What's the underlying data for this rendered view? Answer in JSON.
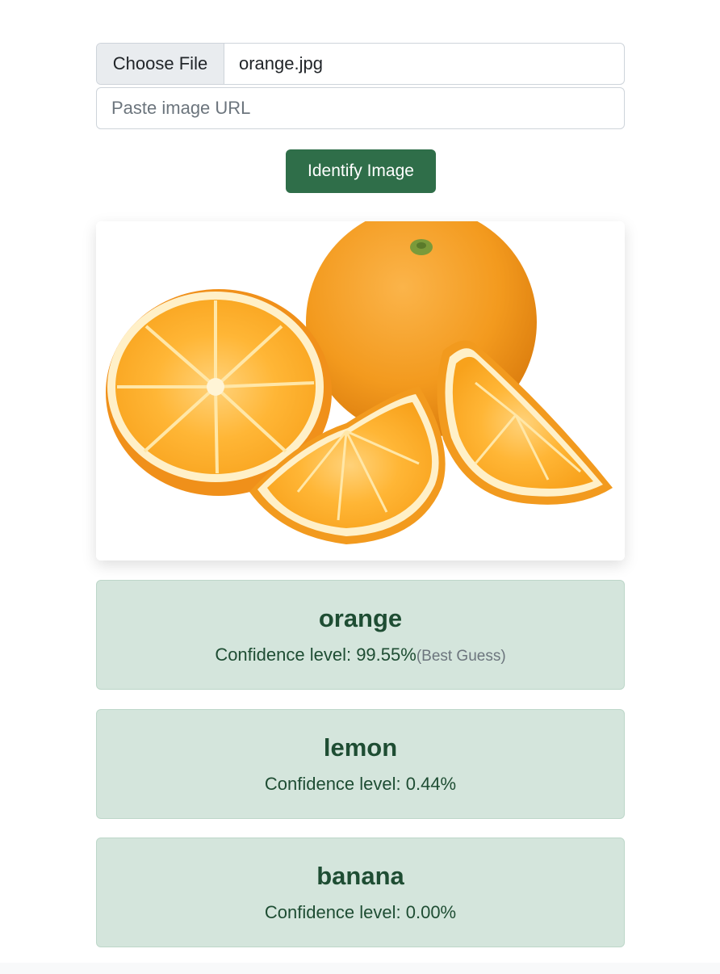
{
  "form": {
    "choose_file_label": "Choose File",
    "file_name": "orange.jpg",
    "url_placeholder": "Paste image URL",
    "url_value": "",
    "submit_label": "Identify Image"
  },
  "preview": {
    "icon": "orange-fruit-image"
  },
  "results": [
    {
      "label": "orange",
      "confidence_text": "Confidence level: 99.55%",
      "note": "(Best Guess)"
    },
    {
      "label": "lemon",
      "confidence_text": "Confidence level: 0.44%",
      "note": ""
    },
    {
      "label": "banana",
      "confidence_text": "Confidence level: 0.00%",
      "note": ""
    }
  ],
  "colors": {
    "button": "#2f6e49",
    "result_bg": "#d4e5dc",
    "result_text": "#1e4d33"
  }
}
